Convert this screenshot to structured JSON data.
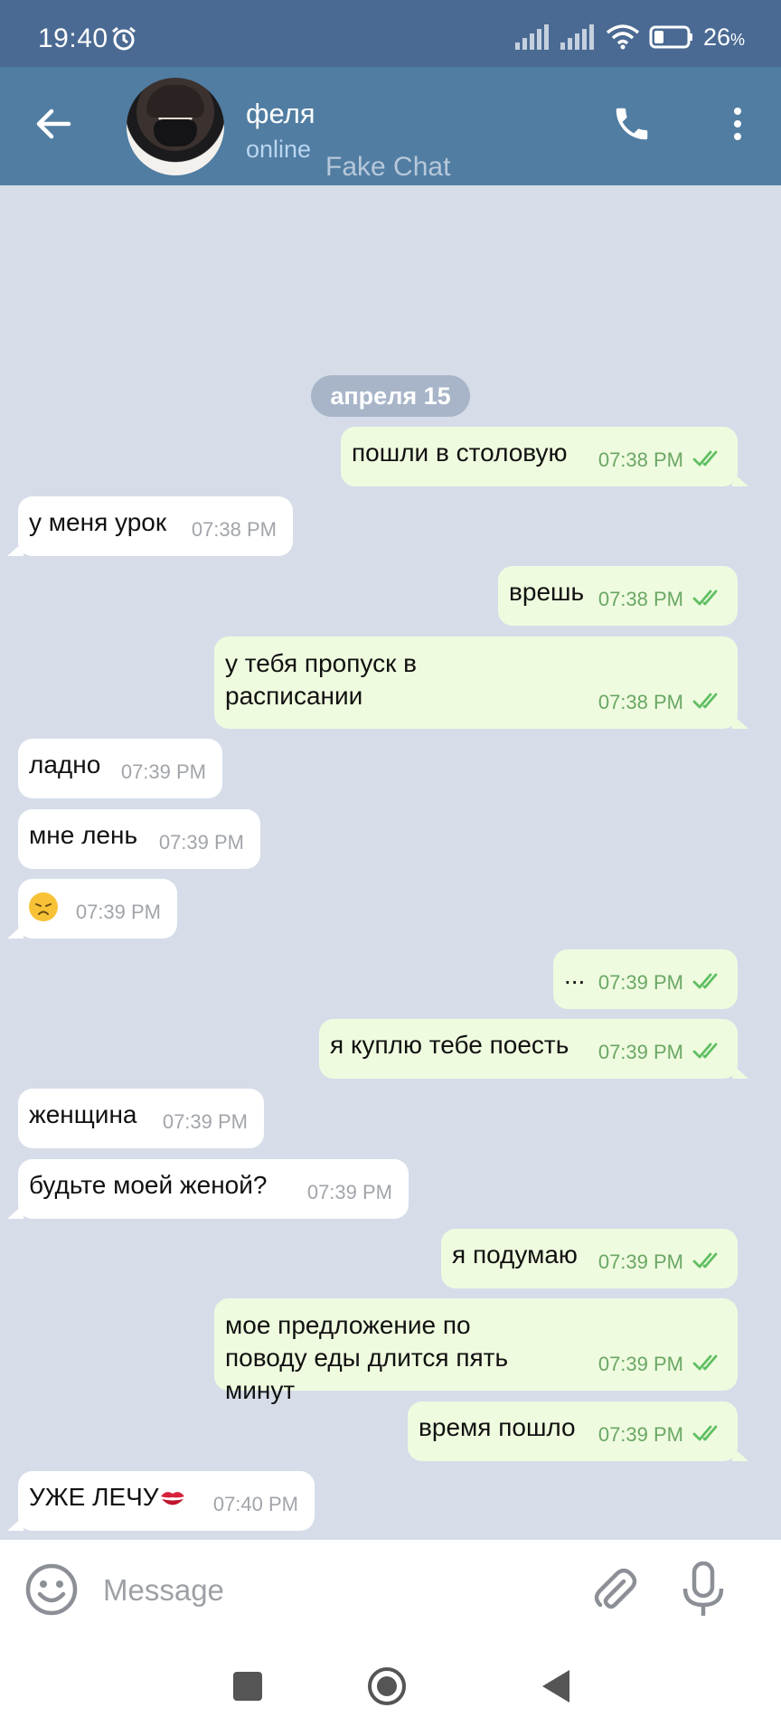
{
  "status_bar": {
    "time": "19:40",
    "battery": "26",
    "battery_unit": "%"
  },
  "header": {
    "name": "феля",
    "status": "online",
    "watermark": "Fake Chat"
  },
  "chat": {
    "date": "апреля 15",
    "messages": [
      {
        "dir": "out",
        "text": "пошли в столовую",
        "time": "07:38 PM"
      },
      {
        "dir": "in",
        "text": "у меня урок",
        "time": "07:38 PM"
      },
      {
        "dir": "out",
        "text": "врешь",
        "time": "07:38 PM"
      },
      {
        "dir": "out",
        "text": "у тебя пропуск в расписании",
        "time": "07:38 PM"
      },
      {
        "dir": "in",
        "text": "ладно",
        "time": "07:39 PM"
      },
      {
        "dir": "in",
        "text": "мне лень",
        "time": "07:39 PM"
      },
      {
        "dir": "in",
        "text": "",
        "emoji": "disappointed-face",
        "time": "07:39 PM"
      },
      {
        "dir": "out",
        "text": "...",
        "time": "07:39 PM"
      },
      {
        "dir": "out",
        "text": "я куплю тебе поесть",
        "time": "07:39 PM"
      },
      {
        "dir": "in",
        "text": "женщина",
        "time": "07:39 PM"
      },
      {
        "dir": "in",
        "text": "будьте моей женой?",
        "time": "07:39 PM"
      },
      {
        "dir": "out",
        "text": "я подумаю",
        "time": "07:39 PM"
      },
      {
        "dir": "out",
        "text": "мое предложение по поводу еды длится пять минут",
        "time": "07:39 PM"
      },
      {
        "dir": "out",
        "text": "время пошло",
        "time": "07:39 PM"
      },
      {
        "dir": "in",
        "text": "УЖЕ ЛЕЧУ",
        "emoji": "kiss-mark",
        "time": "07:40 PM"
      }
    ]
  },
  "input": {
    "placeholder": "Message"
  },
  "colors": {
    "header": "#517da2",
    "status_bar": "#4a6a93",
    "chat_bg": "#d6dde9",
    "outgoing": "#effbdf",
    "incoming": "#ffffff",
    "check": "#5fbf62"
  },
  "icons": [
    "back-arrow-icon",
    "phone-icon",
    "more-vertical-icon",
    "emoji-icon",
    "attach-icon",
    "mic-icon",
    "double-check-icon"
  ]
}
